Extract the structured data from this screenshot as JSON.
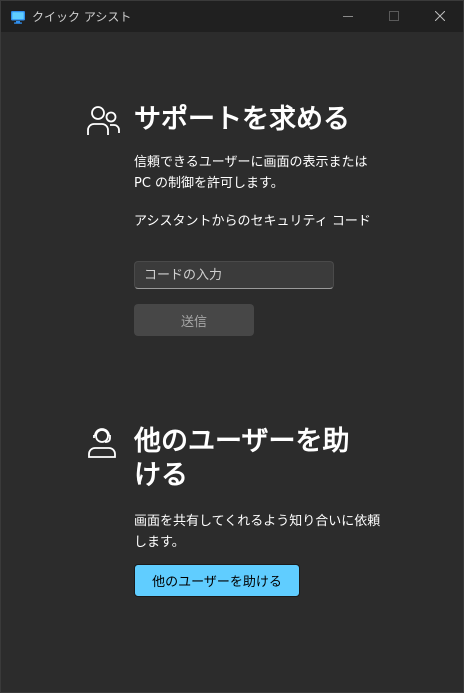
{
  "window": {
    "title": "クイック アシスト",
    "app_icon": "monitor-icon",
    "controls": [
      "minimize-icon",
      "maximize-icon",
      "close-icon"
    ]
  },
  "get_help": {
    "icon": "people-icon",
    "heading": "サポートを求める",
    "description": "信頼できるユーザーに画面の表示または PC の制御を許可します。",
    "code_label": "アシスタントからのセキュリティ コード",
    "code_placeholder": "コードの入力",
    "code_value": "",
    "submit_label": "送信"
  },
  "give_help": {
    "icon": "person-headset-icon",
    "heading_line1": "他のユーザーを助",
    "heading_line2": "ける",
    "description": "画面を共有してくれるよう知り合いに依頼します。",
    "button_label": "他のユーザーを助ける"
  },
  "colors": {
    "background": "#2c2c2c",
    "titlebar": "#202020",
    "accent": "#60cdff",
    "disabled_button": "#474747"
  }
}
